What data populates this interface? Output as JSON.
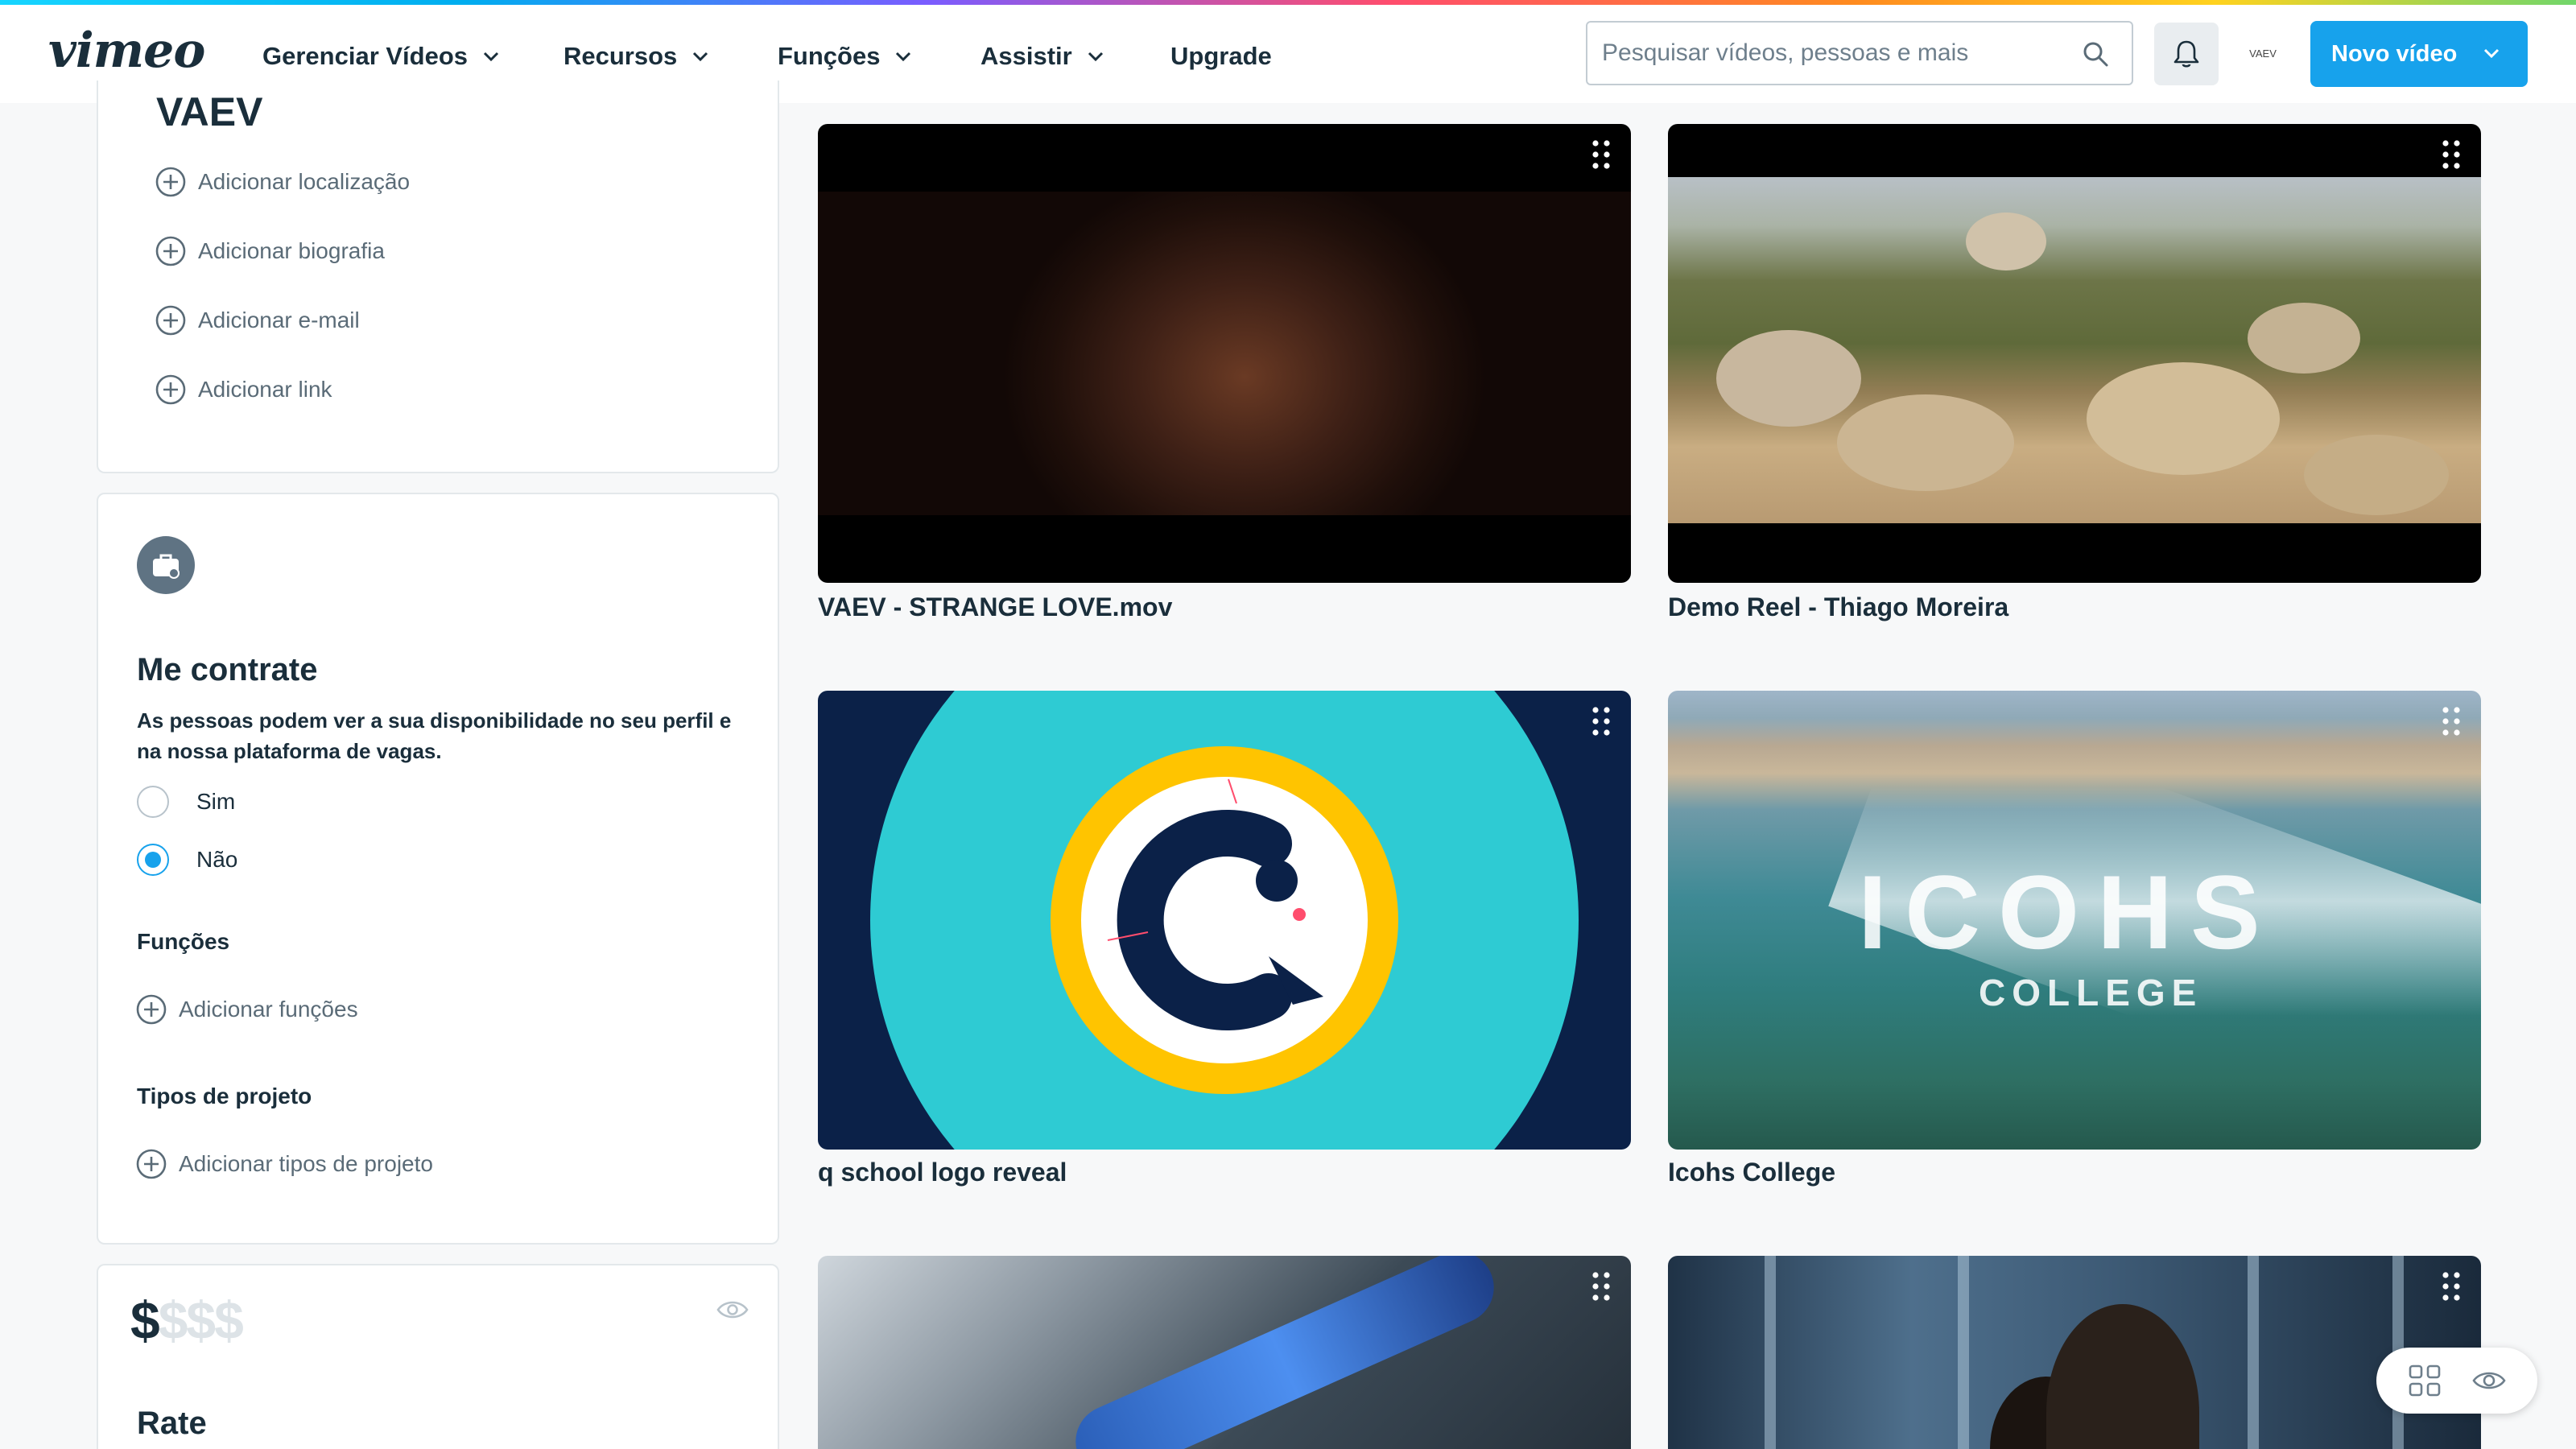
{
  "brand": {
    "logo_text": "vimeo"
  },
  "nav": {
    "items": [
      {
        "label": "Gerenciar Vídeos",
        "has_dropdown": true
      },
      {
        "label": "Recursos",
        "has_dropdown": true
      },
      {
        "label": "Funções",
        "has_dropdown": true
      },
      {
        "label": "Assistir",
        "has_dropdown": true
      },
      {
        "label": "Upgrade",
        "has_dropdown": false
      }
    ],
    "search": {
      "placeholder": "Pesquisar vídeos, pessoas e mais",
      "value": ""
    },
    "avatar_text": "VAEV",
    "new_video_label": "Novo vídeo"
  },
  "profile": {
    "username": "VAEV",
    "add_links": [
      "Adicionar localização",
      "Adicionar biografia",
      "Adicionar e-mail",
      "Adicionar link"
    ]
  },
  "hire": {
    "title": "Me contrate",
    "description": "As pessoas podem ver a sua disponibilidade no seu perfil e na nossa plataforma de vagas.",
    "options": [
      {
        "label": "Sim",
        "selected": false
      },
      {
        "label": "Não",
        "selected": true
      }
    ],
    "roles_heading": "Funções",
    "roles_add": "Adicionar funções",
    "project_types_heading": "Tipos de projeto",
    "project_types_add": "Adicionar tipos de projeto"
  },
  "rate": {
    "dollar_active": "$",
    "dollar_inactive": "$$$",
    "title": "Rate"
  },
  "videos": [
    {
      "title": "VAEV - STRANGE LOVE.mov"
    },
    {
      "title": "Demo Reel - Thiago Moreira"
    },
    {
      "title": "q school logo reveal"
    },
    {
      "title": "Icohs College",
      "overlay_brand": "ICOHS",
      "overlay_sub": "COLLEGE"
    },
    {
      "title": ""
    },
    {
      "title": ""
    }
  ],
  "colors": {
    "accent": "#17a2ec",
    "text": "#1a2e3b",
    "muted": "#5a6b77",
    "logo_teal": "#2ecbd3",
    "logo_yellow": "#ffc400",
    "logo_navy": "#0b2148"
  },
  "icons": {
    "search": "search-icon",
    "bell": "bell-icon",
    "caret": "chevron-down-icon",
    "plus": "plus-circle-icon",
    "briefcase": "briefcase-icon",
    "eye": "eye-icon",
    "drag": "drag-handle-icon",
    "grid": "grid-view-icon"
  }
}
